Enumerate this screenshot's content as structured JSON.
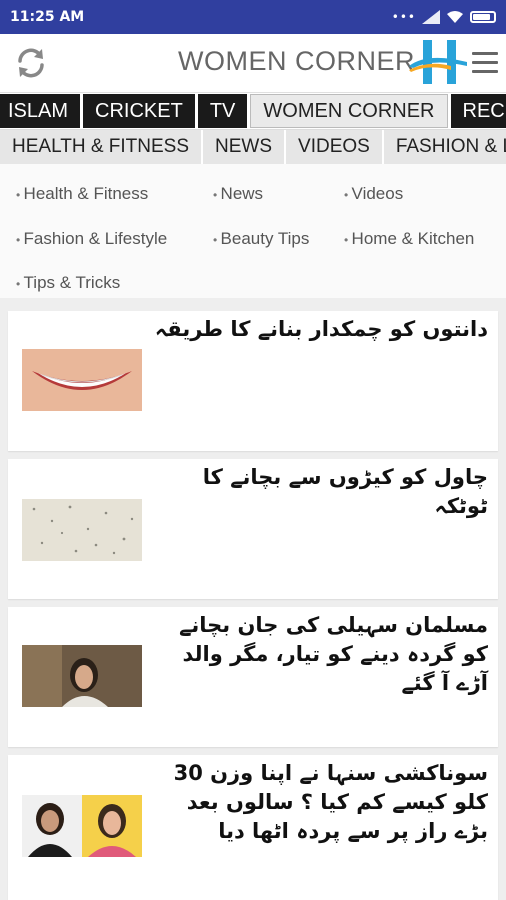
{
  "status_bar": {
    "time": "11:25 AM"
  },
  "header": {
    "title": "WOMEN CORNER"
  },
  "tabs": [
    {
      "label": "ISLAM",
      "active": false
    },
    {
      "label": "CRICKET",
      "active": false
    },
    {
      "label": "TV",
      "active": false
    },
    {
      "label": "WOMEN CORNER",
      "active": true
    },
    {
      "label": "RECIP",
      "active": false
    }
  ],
  "subtabs": [
    "HEALTH & FITNESS",
    "NEWS",
    "VIDEOS",
    "FASHION & L"
  ],
  "links": [
    "Health & Fitness",
    "News",
    "Videos",
    "Fashion & Lifestyle",
    "Beauty Tips",
    "Home & Kitchen",
    "Tips & Tricks"
  ],
  "articles": [
    {
      "title": "دانتوں کو چمکدار بنانے کا طریقہ",
      "thumb": "smile-image"
    },
    {
      "title": "چاول کو کیڑوں سے بچانے کا ٹوٹکہ",
      "thumb": "rice-image"
    },
    {
      "title": "مسلمان سہیلی کی جان بچانے کو گردہ دینے کو تیار، مگر والد آڑے آ گئے",
      "thumb": "woman-image"
    },
    {
      "title": "سوناکشی سنہا نے اپنا وزن 30 کلو کیسے کم کیا ؟ سالوں بعد بڑے راز پر سے پردہ اٹھا دیا",
      "thumb": "sonakshi-image"
    }
  ],
  "colors": {
    "status_bar": "#303f9f",
    "tab_dark": "#1a1a1a",
    "logo_blue": "#29a3d9"
  }
}
